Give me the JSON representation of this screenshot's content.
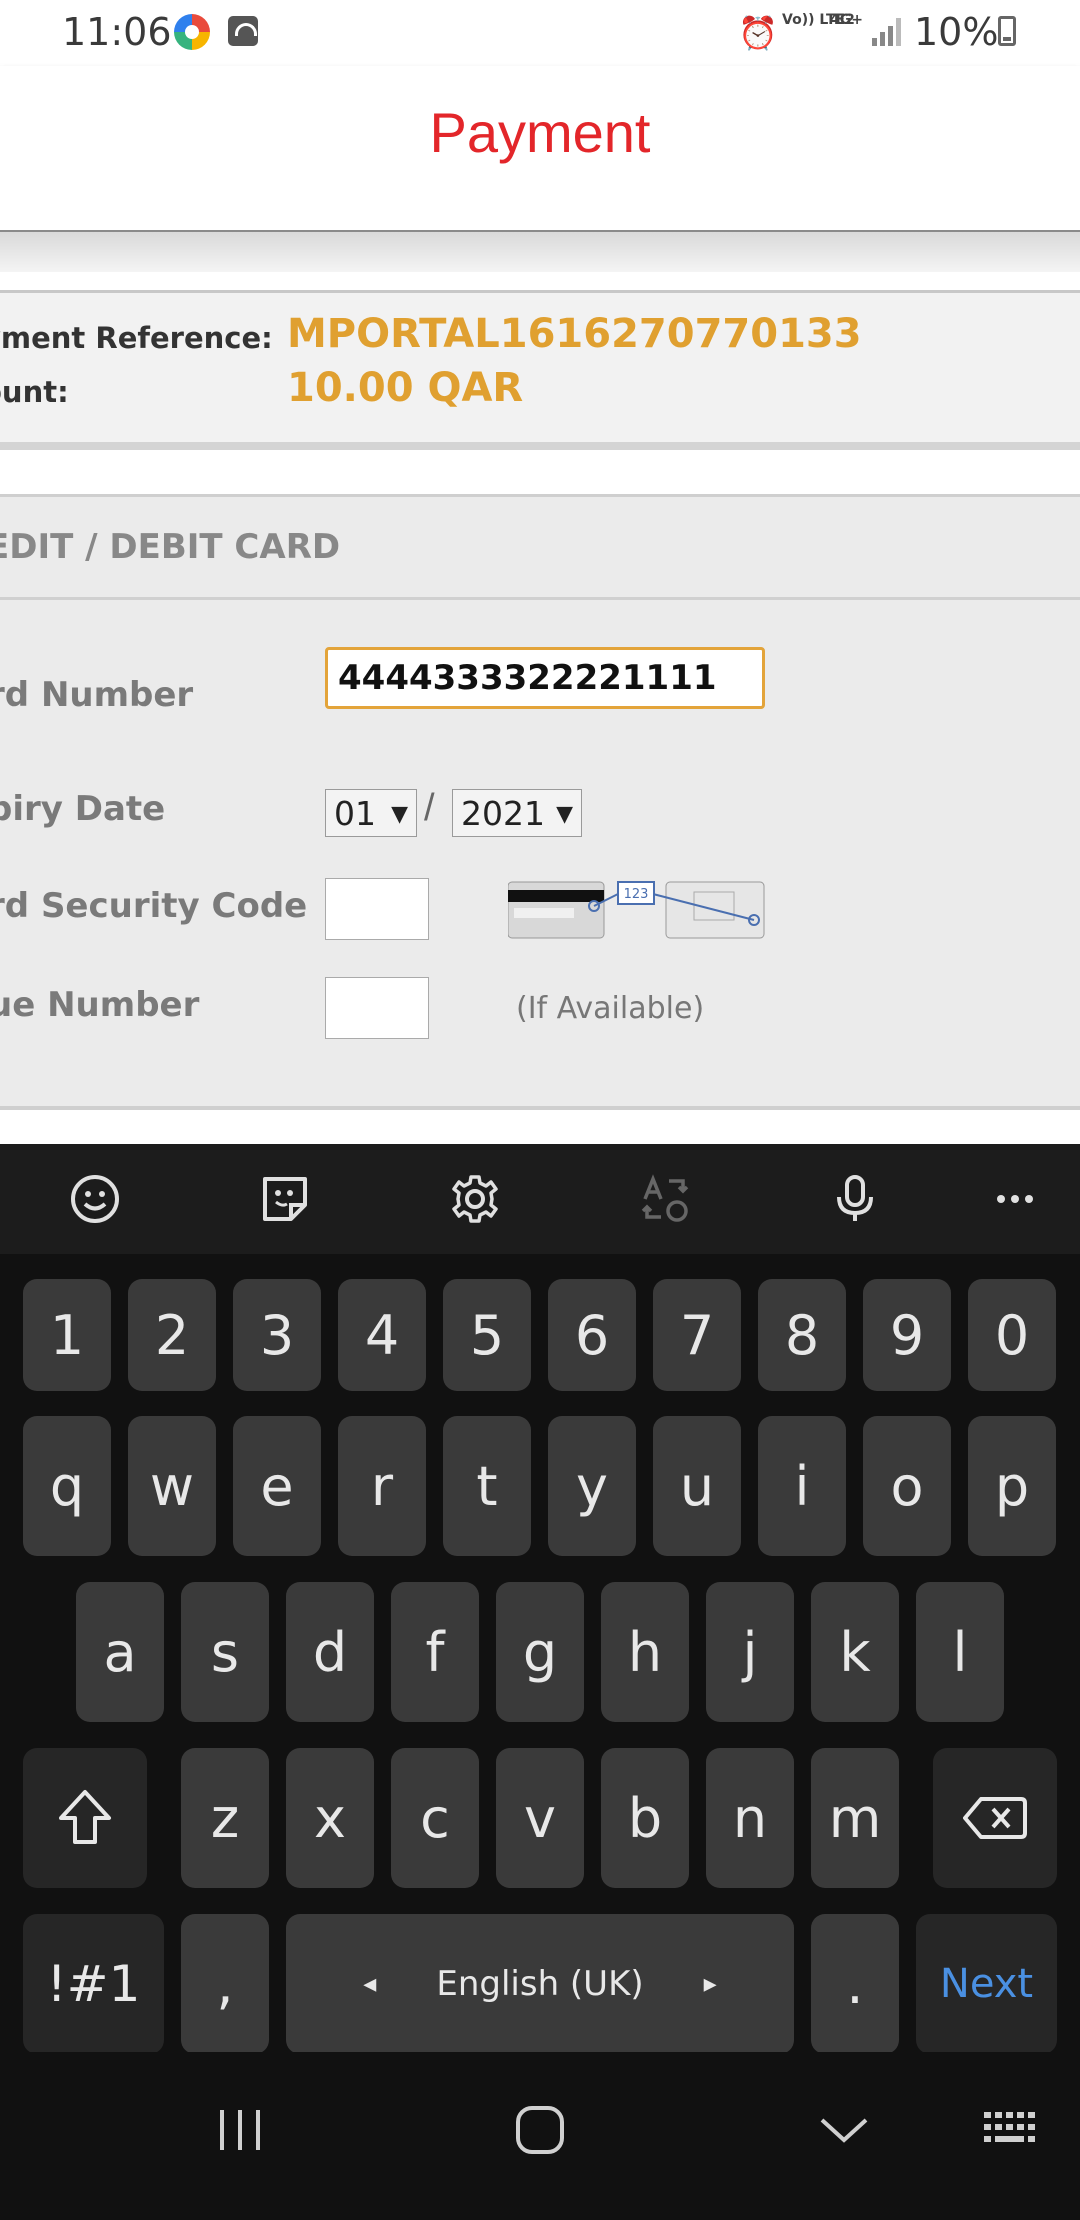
{
  "status_bar": {
    "time": "11:06",
    "battery": "10%",
    "lte_label": "Vo)) LTE2",
    "net_label": "4G+"
  },
  "header": {
    "title": "Payment"
  },
  "summary": {
    "ref_label": "yment Reference:",
    "ref_value": "MPORTAL1616270770133",
    "amount_label": "ount:",
    "amount_value": "10.00 QAR"
  },
  "card": {
    "section_title": "EDIT / DEBIT CARD",
    "number_label": "rd Number",
    "number_value": "4444333322221111",
    "expiry_label": "piry Date",
    "expiry_month": "01",
    "expiry_year": "2021",
    "expiry_separator": "/",
    "csc_label": "rd Security Code",
    "csc_image_text": "123",
    "issue_label": "ue Number",
    "issue_hint": "(If Available)"
  },
  "keyboard": {
    "toolbar_icons": [
      "emoji-icon",
      "sticker-icon",
      "settings-icon",
      "translate-icon",
      "microphone-icon",
      "more-icon"
    ],
    "row_numbers": [
      "1",
      "2",
      "3",
      "4",
      "5",
      "6",
      "7",
      "8",
      "9",
      "0"
    ],
    "row_top": [
      "q",
      "w",
      "e",
      "r",
      "t",
      "y",
      "u",
      "i",
      "o",
      "p"
    ],
    "row_middle": [
      "a",
      "s",
      "d",
      "f",
      "g",
      "h",
      "j",
      "k",
      "l"
    ],
    "row_bottom": [
      "z",
      "x",
      "c",
      "v",
      "b",
      "n",
      "m"
    ],
    "symbols_key": "!#1",
    "comma_key": ",",
    "space_label": "English (UK)",
    "period_key": ".",
    "action_key": "Next",
    "action_color": "#4a90e2"
  },
  "colors": {
    "title": "#e3262a",
    "summary_value": "#e0a030",
    "field_focus": "#e3a43a"
  }
}
